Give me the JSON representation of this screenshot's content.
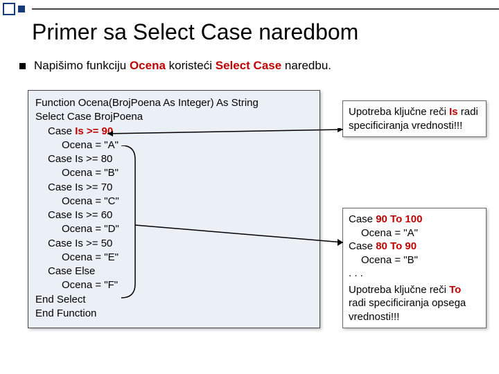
{
  "title": "Primer sa Select Case naredbom",
  "bullet": {
    "pre": "Napišimo funkciju ",
    "fn": "Ocena",
    "mid": " koristeći ",
    "kw": "Select Case",
    "post": " naredbu."
  },
  "code": {
    "l1": "Function Ocena(BrojPoena As Integer) As String",
    "l2": "Select Case BrojPoena",
    "c90a": "Case ",
    "c90b": "Is >= 90",
    "a90": "Ocena = \"A\"",
    "c80": "Case Is >= 80",
    "a80": "Ocena = \"B\"",
    "c70": "Case Is >= 70",
    "a70": "Ocena = \"C\"",
    "c60": "Case Is >= 60",
    "a60": "Ocena = \"D\"",
    "c50": "Case Is >= 50",
    "a50": "Ocena = \"E\"",
    "cElse": "Case Else",
    "aElse": "Ocena = \"F\"",
    "lend1": "End Select",
    "lend2": "End Function"
  },
  "note1": {
    "t1": "Upotreba ključne reči ",
    "is": "Is",
    "t2": " radi specificiranja vrednosti!!!"
  },
  "note2": {
    "l1a": "Case ",
    "l1b": "90 To 100",
    "l2": "Ocena = \"A\"",
    "l3a": "Case ",
    "l3b": "80 To 90",
    "l4": "Ocena = \"B\"",
    "l5": ". . .",
    "t1": "Upotreba ključne reči ",
    "to": "To",
    "t2": " radi specificiranja opsega vrednosti!!!"
  }
}
